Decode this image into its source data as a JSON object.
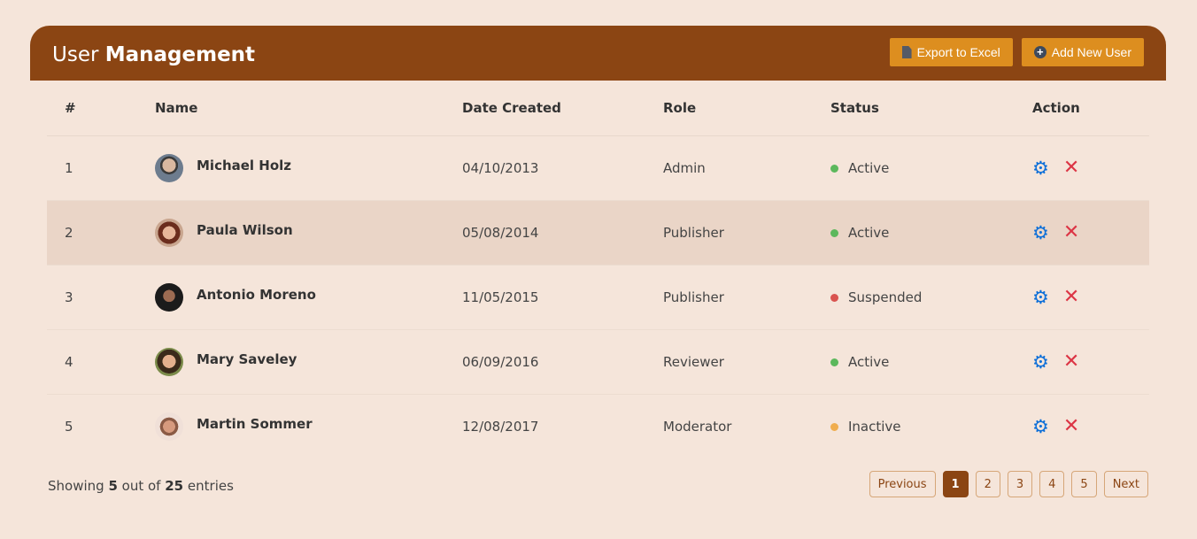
{
  "header": {
    "title_prefix": "User",
    "title_main": "Management",
    "export_label": "Export to Excel",
    "add_label": "Add New User"
  },
  "table": {
    "columns": [
      "#",
      "Name",
      "Date Created",
      "Role",
      "Status",
      "Action"
    ],
    "rows": [
      {
        "num": "1",
        "name": "Michael Holz",
        "date": "04/10/2013",
        "role": "Admin",
        "status": "Active",
        "status_color": "#5cb85c"
      },
      {
        "num": "2",
        "name": "Paula Wilson",
        "date": "05/08/2014",
        "role": "Publisher",
        "status": "Active",
        "status_color": "#5cb85c"
      },
      {
        "num": "3",
        "name": "Antonio Moreno",
        "date": "11/05/2015",
        "role": "Publisher",
        "status": "Suspended",
        "status_color": "#d9534f"
      },
      {
        "num": "4",
        "name": "Mary Saveley",
        "date": "06/09/2016",
        "role": "Reviewer",
        "status": "Active",
        "status_color": "#5cb85c"
      },
      {
        "num": "5",
        "name": "Martin Sommer",
        "date": "12/08/2017",
        "role": "Moderator",
        "status": "Inactive",
        "status_color": "#f0ad4e"
      }
    ]
  },
  "footer": {
    "showing_prefix": "Showing",
    "shown_count": "5",
    "out_of": "out of",
    "total_count": "25",
    "entries": "entries"
  },
  "pagination": {
    "previous": "Previous",
    "pages": [
      "1",
      "2",
      "3",
      "4",
      "5"
    ],
    "active_page": "1",
    "next": "Next"
  },
  "colors": {
    "header_bg": "#8b4513",
    "button_bg": "#dd8e1f",
    "settings_icon": "#0d6fd8",
    "delete_icon": "#dc3545"
  },
  "icons": {
    "export": "file-icon",
    "add": "plus-circle-icon",
    "settings": "gear-icon",
    "delete": "close-icon"
  }
}
